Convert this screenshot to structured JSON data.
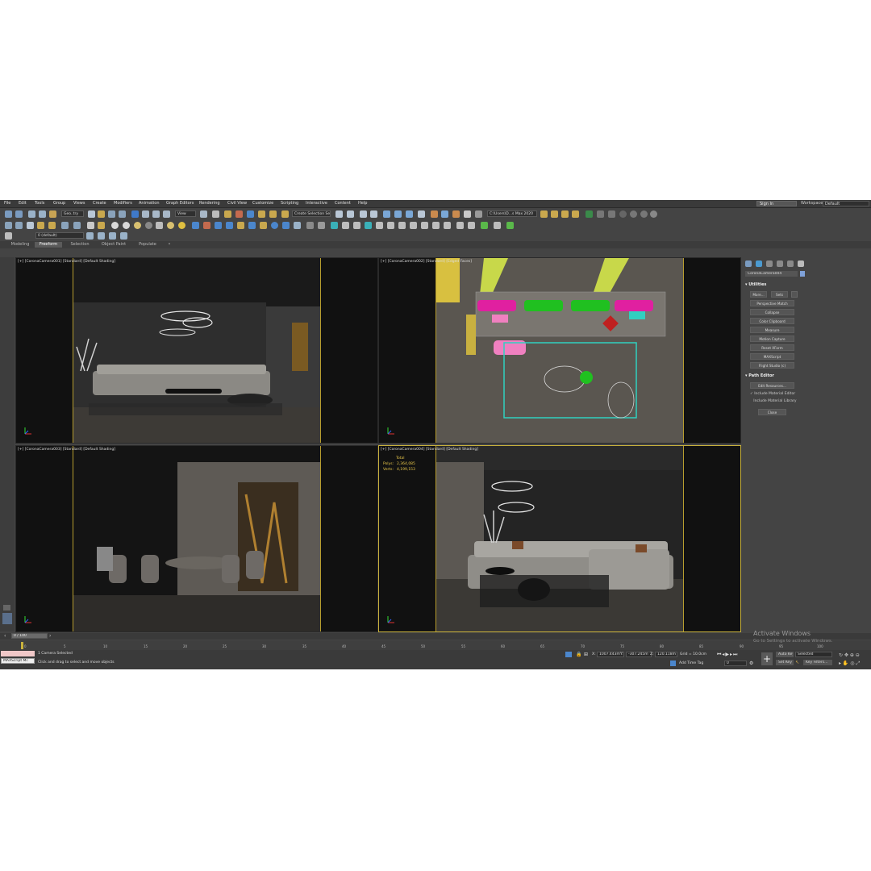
{
  "menu": [
    "File",
    "Edit",
    "Tools",
    "Group",
    "Views",
    "Create",
    "Modifiers",
    "Animation",
    "Graph Editors",
    "Rendering",
    "Civil View",
    "Customize",
    "Scripting",
    "Interactive",
    "Content",
    "Help"
  ],
  "account": {
    "signin": "Sign In"
  },
  "workspace": {
    "label": "Workspaces:",
    "value": "Default"
  },
  "toolbar": {
    "selection_filter": "Geo..try",
    "ref_coord": "View",
    "named_selection": "Create Selection Se",
    "project_path": "C:\\Users\\D...s Max 2020"
  },
  "layer": {
    "name": "0 (default)"
  },
  "ribbon_tabs": [
    {
      "label": "Modeling",
      "active": false
    },
    {
      "label": "Freeform",
      "active": true
    },
    {
      "label": "Selection",
      "active": false
    },
    {
      "label": "Object Paint",
      "active": false
    },
    {
      "label": "Populate",
      "active": false
    }
  ],
  "viewports": {
    "tl": {
      "label": "[+] [CoronaCamera001] [Standard] [Default Shading]"
    },
    "tr": {
      "label": "[+] [CoronaCamera002] [Standard] [Edged Faces]"
    },
    "bl": {
      "label": "[+] [CoronaCamera003] [Standard] [Default Shading]"
    },
    "br": {
      "label": "[+] [CoronaCamera004] [Standard] [Default Shading]",
      "stats": {
        "total": "Total",
        "polys_label": "Polys:",
        "polys": "2,364,085",
        "verts_label": "Verts:",
        "verts": "4,199,153"
      }
    }
  },
  "command_panel": {
    "object_name": "CoronaCamera004",
    "utilities": {
      "title": "Utilities",
      "more": "More...",
      "sets": "Sets",
      "buttons": [
        "Perspective Match",
        "Collapse",
        "Color Clipboard",
        "Measure",
        "Motion Capture",
        "Reset XForm",
        "MAXScript",
        "Flight Studio (c)"
      ]
    },
    "path_editor": {
      "title": "Path Editor",
      "edit_resources": "Edit Resources...",
      "include_material_editor": "Include Material Editor",
      "include_material_library": "Include Material Library",
      "close": "Close"
    }
  },
  "timeline": {
    "frame": "0 / 100",
    "ticks": [
      "0",
      "5",
      "10",
      "15",
      "20",
      "25",
      "30",
      "35",
      "40",
      "45",
      "50",
      "55",
      "60",
      "65",
      "70",
      "75",
      "80",
      "85",
      "90",
      "95",
      "100"
    ]
  },
  "status": {
    "maxscript": "MAXScript Mi:",
    "selection": "1 Camera Selected",
    "prompt": "Click and drag to select and move objects",
    "x_label": "X:",
    "x": "1007.443m",
    "y_label": "Y:",
    "y": "-307.245m",
    "z_label": "Z:",
    "z": "120.118m",
    "grid": "Grid = 10.0cm",
    "add_time_tag": "Add Time Tag",
    "auto_key": "Auto Key",
    "set_key": "Set Key",
    "selected": "Selected",
    "key_filters": "Key Filters...",
    "frame_value": "0"
  },
  "watermark": {
    "title": "Activate Windows",
    "subtitle": "Go to Settings to activate Windows."
  }
}
